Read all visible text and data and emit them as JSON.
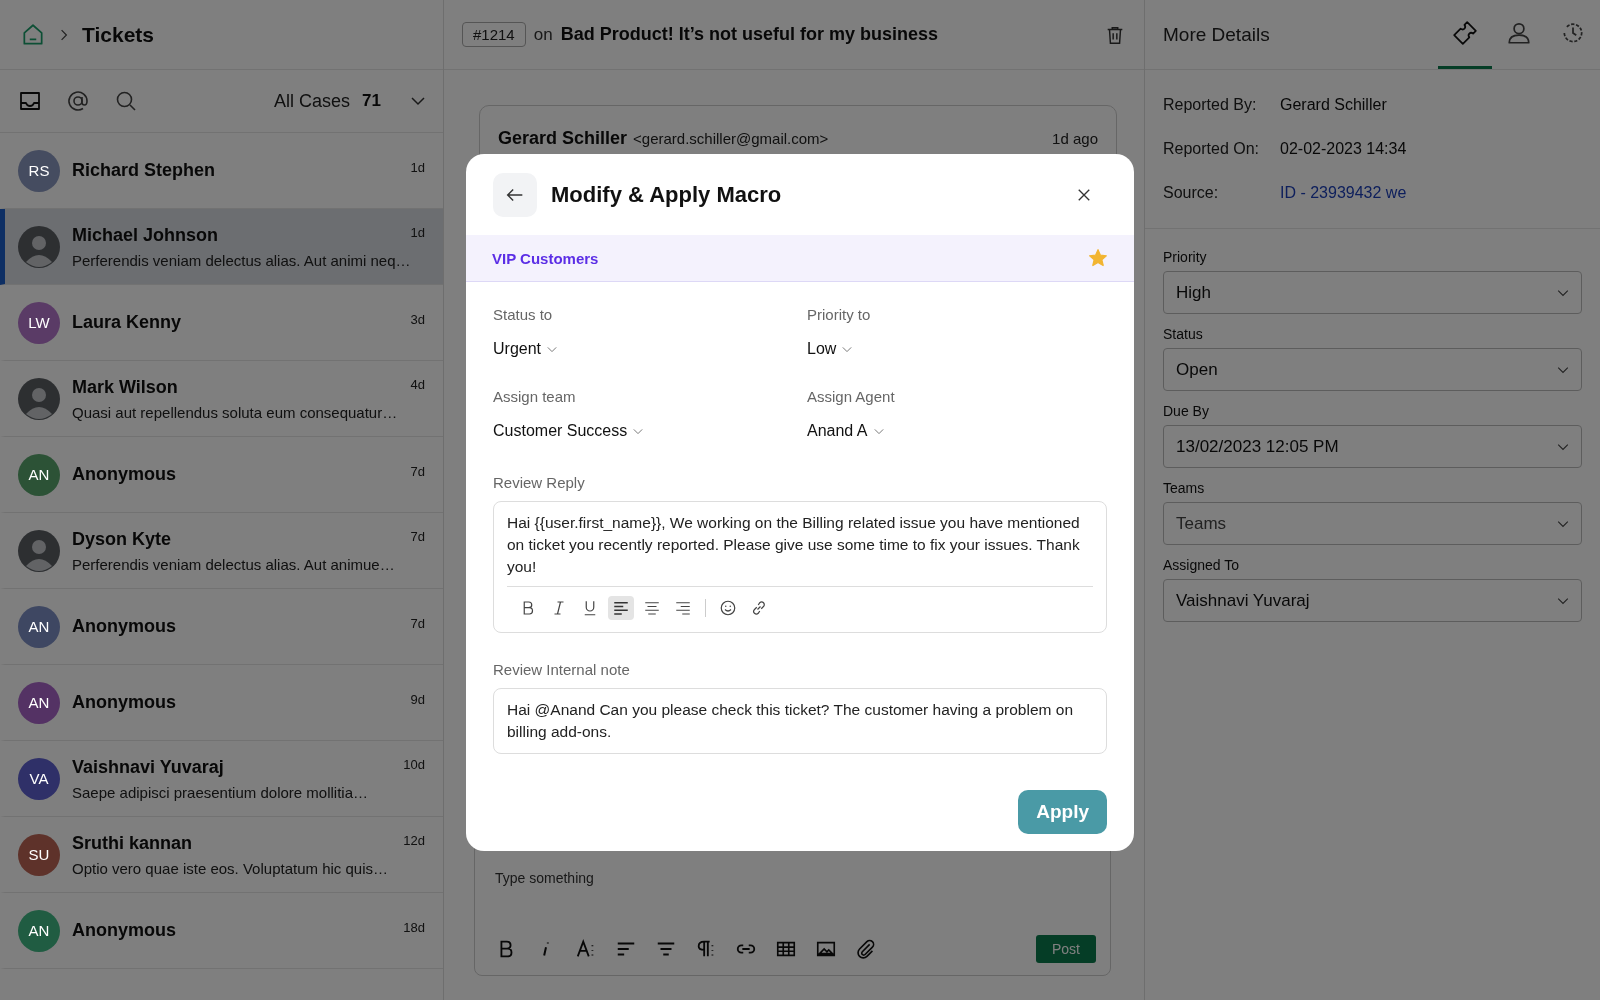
{
  "header": {
    "title": "Tickets"
  },
  "list_toolbar": {
    "filter_label": "All Cases",
    "filter_count": "71"
  },
  "tickets": [
    {
      "kind": "initials",
      "initials": "RS",
      "color": "#454c60",
      "name": "Richard Stephen",
      "time": "1d",
      "selected": false
    },
    {
      "kind": "photo",
      "name": "Michael Johnson",
      "time": "1d",
      "preview": "Perferendis veniam delectus alias. Aut animi neq…",
      "selected": true
    },
    {
      "kind": "initials",
      "initials": "LW",
      "color": "#5a3b66",
      "name": "Laura Kenny",
      "time": "3d",
      "selected": false
    },
    {
      "kind": "photo",
      "name": "Mark Wilson",
      "time": "4d",
      "preview": "Quasi aut repellendus soluta eum consequatur…",
      "selected": false
    },
    {
      "kind": "initials",
      "initials": "AN",
      "color": "#2c5236",
      "name": "Anonymous",
      "time": "7d",
      "selected": false
    },
    {
      "kind": "photo",
      "name": "Dyson Kyte",
      "time": "7d",
      "preview": "Perferendis veniam delectus alias. Aut animue…",
      "selected": false
    },
    {
      "kind": "initials",
      "initials": "AN",
      "color": "#3e4762",
      "name": "Anonymous",
      "time": "7d",
      "selected": false
    },
    {
      "kind": "initials",
      "initials": "AN",
      "color": "#543264",
      "name": "Anonymous",
      "time": "9d",
      "selected": false
    },
    {
      "kind": "initials",
      "initials": "VA",
      "color": "#2f3068",
      "name": "Vaishnavi Yuvaraj",
      "time": "10d",
      "preview": "Saepe adipisci praesentium dolore mollitia…",
      "selected": false
    },
    {
      "kind": "initials",
      "initials": "SU",
      "color": "#5e322a",
      "name": "Sruthi kannan",
      "time": "12d",
      "preview": "Optio vero quae iste eos. Voluptatum hic quis…",
      "selected": false
    },
    {
      "kind": "initials",
      "initials": "AN",
      "color": "#205c42",
      "name": "Anonymous",
      "time": "18d",
      "selected": false
    }
  ],
  "ticket": {
    "id": "#1214",
    "connector": "on",
    "title": "Bad Product! It’s not useful for my business"
  },
  "message": {
    "sender": "Gerard Schiller",
    "email": "<gerard.schiller@gmail.com>",
    "time": "1d ago"
  },
  "composer": {
    "placeholder": "Type something",
    "post_label": "Post"
  },
  "details": {
    "title": "More Details",
    "tabs": [
      {
        "kind": "ticket",
        "selected": true
      },
      {
        "kind": "person",
        "selected": false
      },
      {
        "kind": "history",
        "selected": false
      }
    ],
    "info": [
      {
        "kind": "text",
        "label": "Reported By:",
        "value": "Gerard Schiller"
      },
      {
        "kind": "text",
        "label": "Reported On:",
        "value": "02-02-2023 14:34"
      },
      {
        "kind": "link",
        "label": "Source:",
        "value": "ID - 23939432 we"
      }
    ],
    "fields": [
      {
        "label": "Priority",
        "value": "High"
      },
      {
        "label": "Status",
        "value": "Open"
      },
      {
        "label": "Due By",
        "value": "13/02/2023 12:05 PM"
      },
      {
        "label": "Teams",
        "placeholder": "Teams"
      },
      {
        "label": "Assigned To",
        "value": "Vaishnavi Yuvaraj"
      }
    ]
  },
  "modal": {
    "title": "Modify & Apply Macro",
    "group": "VIP Customers",
    "starred": true,
    "selects": [
      {
        "label": "Status to",
        "value": "Urgent"
      },
      {
        "label": "Priority to",
        "value": "Low"
      },
      {
        "label": "Assign team",
        "value": "Customer Success"
      },
      {
        "label": "Assign Agent",
        "value": "Anand A"
      }
    ],
    "reply_label": "Review Reply",
    "reply_text": "Hai {{user.first_name}}, We working on the Billing related issue you have mentioned on ticket you recently reported. Please give use some time to fix your issues. Thank you!",
    "reply_toolbar": [
      {
        "kind": "bold",
        "selected": false
      },
      {
        "kind": "italic",
        "selected": false
      },
      {
        "kind": "underline",
        "selected": false
      },
      {
        "kind": "align-left",
        "selected": true
      },
      {
        "kind": "align-center",
        "selected": false
      },
      {
        "kind": "align-right",
        "selected": false
      },
      {
        "kind": "emoji",
        "selected": false
      },
      {
        "kind": "link",
        "selected": false
      }
    ],
    "note_label": "Review Internal note",
    "note_text": "Hai @Anand Can you please check this ticket? The customer having a problem on billing add-ons.",
    "apply_label": "Apply"
  }
}
